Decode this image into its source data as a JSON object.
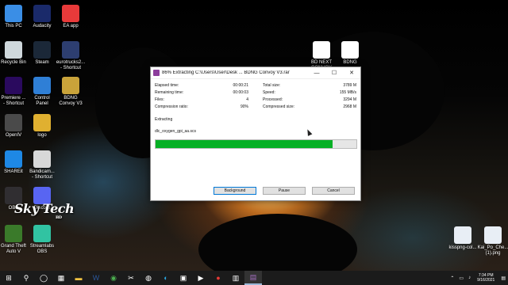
{
  "desktop": {
    "icons": [
      {
        "label": "This PC",
        "icon": "computer-icon"
      },
      {
        "label": "Audacity",
        "icon": "audacity-icon"
      },
      {
        "label": "EA app",
        "icon": "ea-icon"
      },
      {
        "label": "Recycle Bin",
        "icon": "recycle-bin-icon"
      },
      {
        "label": "Steam",
        "icon": "steam-icon"
      },
      {
        "label": "eurotrucks2...\n- Shortcut",
        "icon": "euro-truck-icon"
      },
      {
        "label": "Premiere ...\n- Shortcut",
        "icon": "premiere-icon"
      },
      {
        "label": "Control\nPanel",
        "icon": "control-panel-icon"
      },
      {
        "label": "BDNG\nConvoy V3",
        "icon": "winrar-archive-icon"
      },
      {
        "label": "OpenIV",
        "icon": "openiv-icon"
      },
      {
        "label": "logo",
        "icon": "image-file-icon"
      },
      {
        "label": "SHAREit",
        "icon": "shareit-icon"
      },
      {
        "label": "Bandicam...\n- Shortcut",
        "icon": "bandicam-icon"
      },
      {
        "label": "OBS",
        "icon": "obs-icon"
      },
      {
        "label": "Discord",
        "icon": "discord-icon"
      },
      {
        "label": "Grand Theft\nAuto V",
        "icon": "gta-icon"
      },
      {
        "label": "Streamlabs\nOBS",
        "icon": "streamlabs-icon"
      },
      {
        "label": "BD NEXT\nCONVOY",
        "icon": "document-icon"
      },
      {
        "label": "BDNG",
        "icon": "document-icon"
      },
      {
        "label": "kisspng-col...",
        "icon": "png-file-icon"
      },
      {
        "label": "Kai_Po_Che...\n(1).png",
        "icon": "png-file-icon"
      }
    ]
  },
  "dialog": {
    "title": "86% Extracting C:\\Users\\User\\Desk ... BDNG Convoy V3.rar",
    "window_buttons": {
      "minimize": "—",
      "maximize": "☐",
      "close": "✕"
    },
    "stats_left": [
      {
        "label": "Elapsed time:",
        "value": "00:00:21"
      },
      {
        "label": "Remaining time:",
        "value": "00:00:03"
      },
      {
        "label": "Files:",
        "value": "4"
      },
      {
        "label": "Compression ratio:",
        "value": "90%"
      }
    ],
    "stats_right": [
      {
        "label": "Total size:",
        "value": "3789 M"
      },
      {
        "label": "Speed:",
        "value": "155 MB/s"
      },
      {
        "label": "Processed:",
        "value": "3294 M"
      },
      {
        "label": "Compressed size:",
        "value": "2968 M"
      }
    ],
    "status": "Extracting",
    "current_file": "dlc_oxygen_gpi_aa.scs",
    "progress_percent": 88,
    "buttons": {
      "background": "Background",
      "pause": "Pause",
      "cancel": "Cancel"
    }
  },
  "watermark": {
    "main": "Sky Tech",
    "sub": "BD"
  },
  "taskbar": {
    "items": [
      {
        "icon": "start-windows-icon",
        "active": false
      },
      {
        "icon": "search-icon",
        "active": false
      },
      {
        "icon": "task-view-icon",
        "active": false
      },
      {
        "icon": "widgets-icon",
        "active": false
      },
      {
        "icon": "file-explorer-icon",
        "active": false
      },
      {
        "icon": "word-icon",
        "active": false
      },
      {
        "icon": "chrome-icon",
        "active": false
      },
      {
        "icon": "capcut-icon",
        "active": false
      },
      {
        "icon": "steam-icon",
        "active": false
      },
      {
        "icon": "edge-icon",
        "active": false
      },
      {
        "icon": "photos-icon",
        "active": false
      },
      {
        "icon": "media-player-icon",
        "active": false
      },
      {
        "icon": "obs-record-icon",
        "active": false
      },
      {
        "icon": "task-manager-icon",
        "active": false
      },
      {
        "icon": "winrar-icon",
        "active": true
      }
    ],
    "time": "7:34 PM",
    "date": "9/16/2021"
  },
  "colors": {
    "progress_fill": "#06b025",
    "progress_track": "#e6e6e6",
    "taskbar_bg": "#1b1b1b",
    "button_bg": "#e1e1e1",
    "default_button_border": "#0078d7"
  }
}
